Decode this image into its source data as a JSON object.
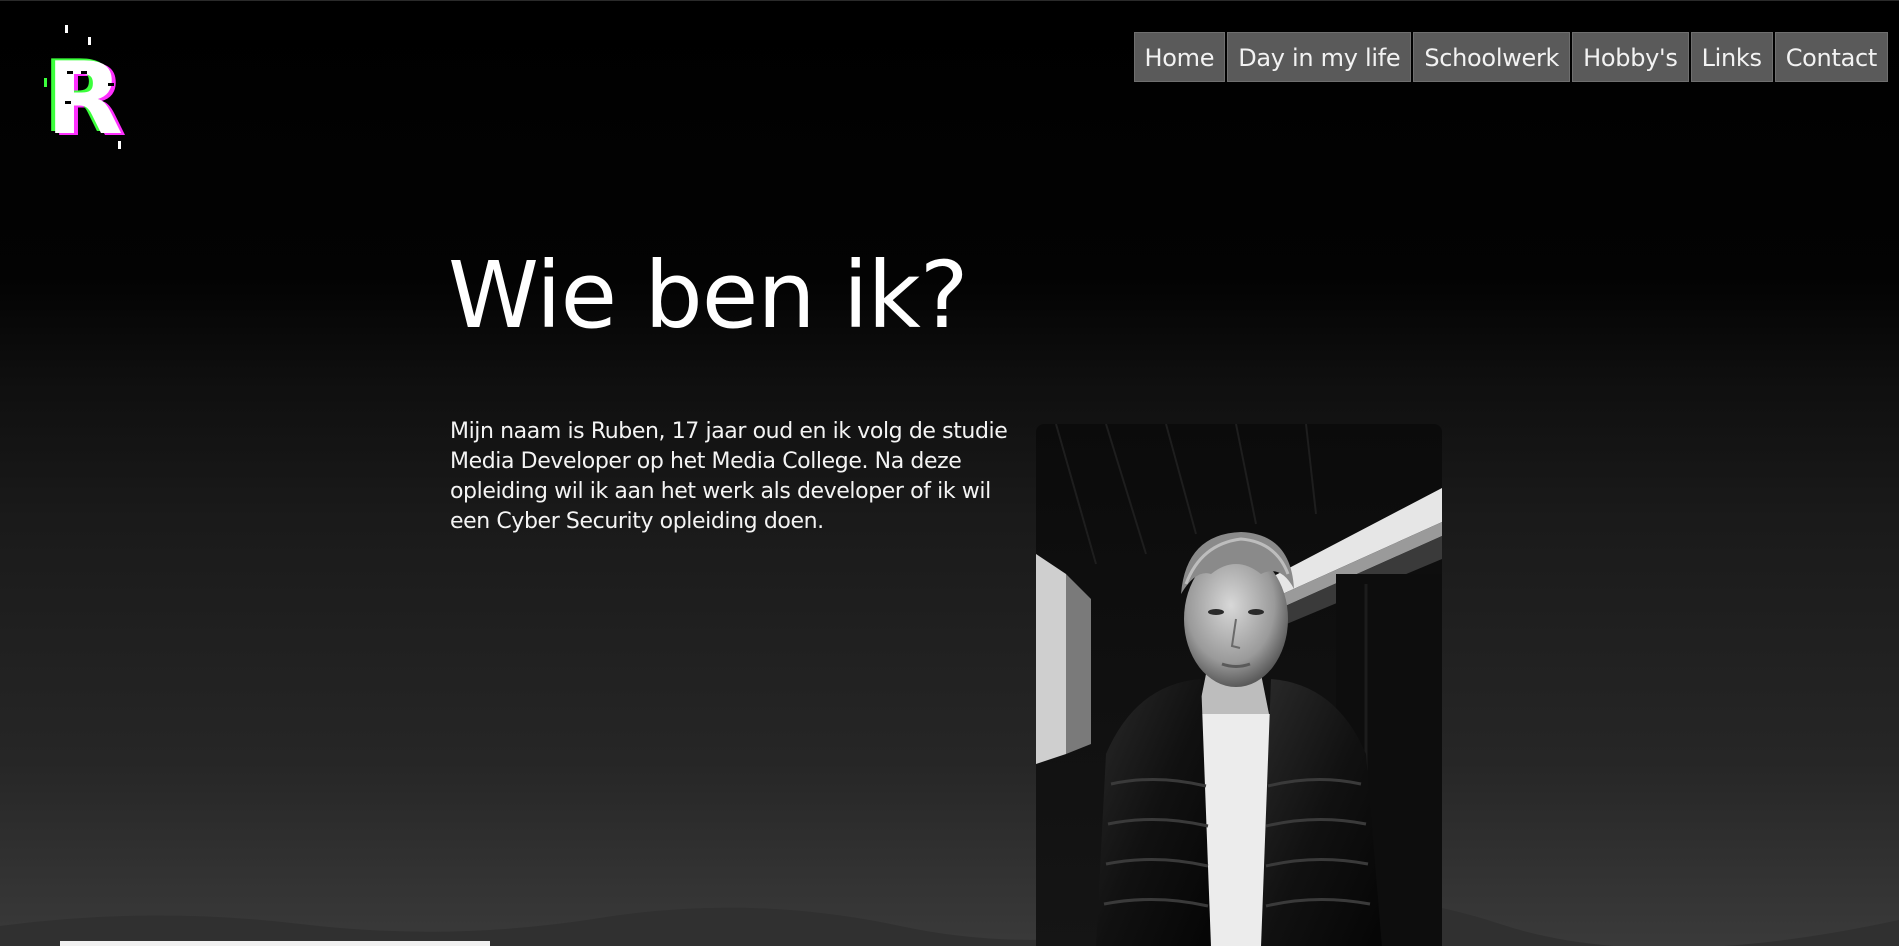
{
  "logo": {
    "icon": "r-glitch-logo-icon",
    "letter": "R"
  },
  "nav": {
    "items": [
      {
        "label": "Home"
      },
      {
        "label": "Day in my life"
      },
      {
        "label": "Schoolwerk"
      },
      {
        "label": "Hobby's"
      },
      {
        "label": "Links"
      },
      {
        "label": "Contact"
      }
    ]
  },
  "main": {
    "title": "Wie ben ik?",
    "intro": "Mijn naam is Ruben, 17 jaar oud en ik volg de studie Media Developer op het Media College. Na deze opleiding wil ik aan het werk als developer of ik wil een Cyber Security opleiding doen.",
    "portrait": "portrait-photo"
  },
  "colors": {
    "background": "#000000",
    "nav_bg": "#5a5a5a",
    "text": "#ffffff",
    "logo_glitch_green": "#3cff3c",
    "logo_glitch_magenta": "#ff30ff"
  }
}
